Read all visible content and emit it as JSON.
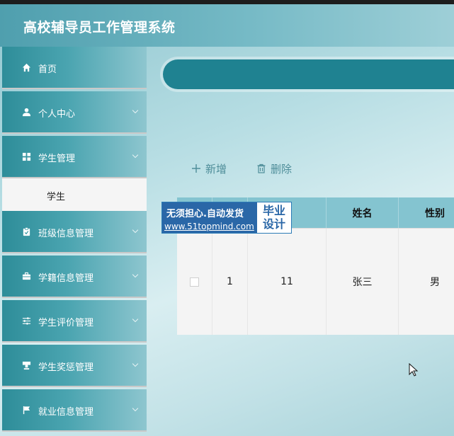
{
  "app": {
    "title": "高校辅导员工作管理系统"
  },
  "sidebar": {
    "items": [
      {
        "label": "首页",
        "icon": "home-icon",
        "expandable": false
      },
      {
        "label": "个人中心",
        "icon": "user-icon",
        "expandable": true
      },
      {
        "label": "学生管理",
        "icon": "grid-icon",
        "expandable": true,
        "expanded": true
      },
      {
        "label": "班级信息管理",
        "icon": "clipboard-icon",
        "expandable": true
      },
      {
        "label": "学籍信息管理",
        "icon": "briefcase-icon",
        "expandable": true
      },
      {
        "label": "学生评价管理",
        "icon": "sliders-icon",
        "expandable": true
      },
      {
        "label": "学生奖惩管理",
        "icon": "stamp-icon",
        "expandable": true
      },
      {
        "label": "就业信息管理",
        "icon": "flag-icon",
        "expandable": true
      }
    ],
    "active_sub_item": "学生"
  },
  "toolbar": {
    "add_label": "新增",
    "delete_label": "删除"
  },
  "table": {
    "columns": [
      "",
      "",
      "号",
      "姓名",
      "性别"
    ],
    "rows": [
      {
        "index": "1",
        "id": "11",
        "name": "张三",
        "gender": "男"
      }
    ]
  },
  "watermark": {
    "line1": "无须担心.自动发货",
    "line2": "www.51topmind.com",
    "right_top": "毕业",
    "right_bottom": "设计"
  },
  "colors": {
    "header": "#4f9fae",
    "search_bar": "#1f8291",
    "table_header": "#84c4d0",
    "button_text": "#4e8d99"
  }
}
